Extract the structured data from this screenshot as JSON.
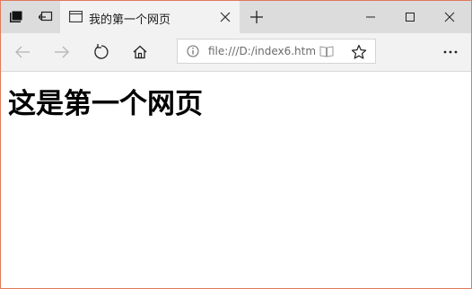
{
  "tab": {
    "title": "我的第一个网页"
  },
  "address_bar": {
    "url": "file:///D:/index6.html"
  },
  "page": {
    "heading": "这是第一个网页"
  },
  "colors": {
    "window_border": "#e07a5f",
    "tabbar_bg": "#dcdcdc",
    "toolbar_bg": "#f2f2f2"
  },
  "icons": {
    "tab_preview": "tab-preview-icon",
    "set_aside": "set-aside-tabs-icon",
    "tab_page": "page-icon",
    "tab_close": "close-icon",
    "new_tab": "plus-icon",
    "minimize": "minimize-icon",
    "maximize": "maximize-icon",
    "close_window": "close-icon",
    "back": "back-arrow-icon",
    "forward": "forward-arrow-icon",
    "refresh": "refresh-icon",
    "home": "home-icon",
    "info": "info-icon",
    "reading_view": "reading-view-icon",
    "favorite": "star-icon",
    "more": "more-icon"
  }
}
